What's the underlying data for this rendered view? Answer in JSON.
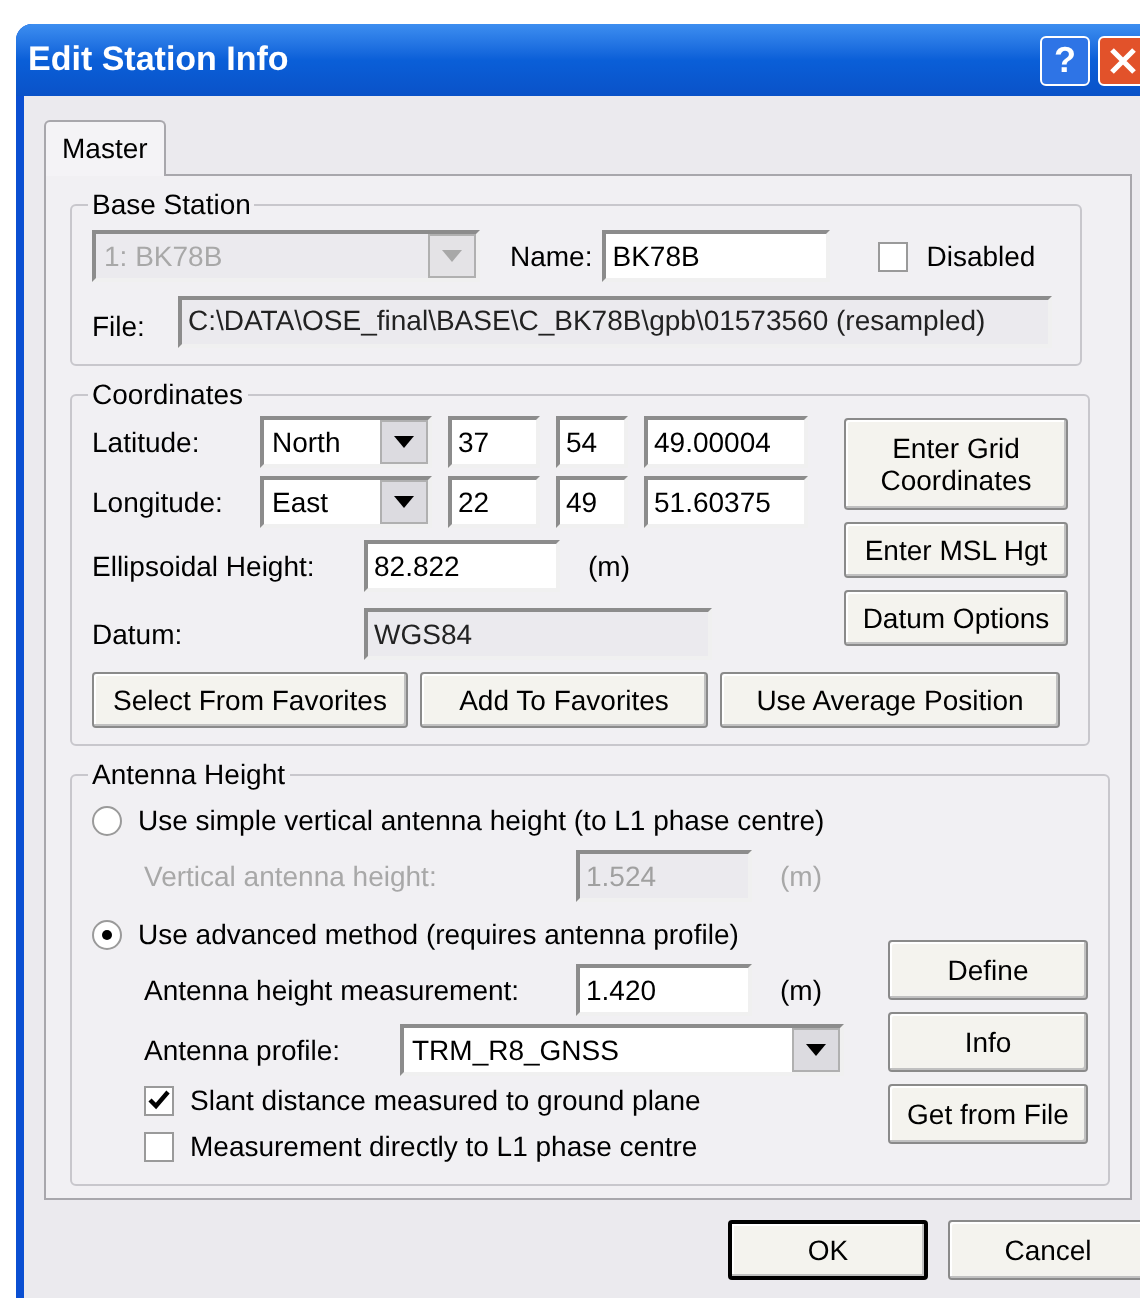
{
  "window": {
    "title": "Edit Station Info",
    "help_button": "?"
  },
  "tabs": [
    {
      "label": "Master",
      "selected": true
    }
  ],
  "base_station": {
    "title": "Base Station",
    "station": {
      "value": "1: BK78B",
      "disabled": true
    },
    "name_label": "Name:",
    "name_value": "BK78B",
    "disabled_checkbox": {
      "label": "Disabled",
      "checked": false
    },
    "file_label": "File:",
    "file_value": "C:\\DATA\\OSE_final\\BASE\\C_BK78B\\gpb\\01573560 (resampled)"
  },
  "coordinates": {
    "title": "Coordinates",
    "rows": [
      {
        "label": "Latitude:",
        "hemisphere": "North",
        "degrees": "37",
        "minutes": "54",
        "seconds": "49.00004"
      },
      {
        "label": "Longitude:",
        "hemisphere": "East",
        "degrees": "22",
        "minutes": "49",
        "seconds": "51.60375"
      }
    ],
    "height_label": "Ellipsoidal Height:",
    "height_value": "82.822",
    "height_unit": "(m)",
    "datum_label": "Datum:",
    "datum_value": "WGS84",
    "side_buttons": [
      "Enter Grid Coordinates",
      "Enter MSL Hgt",
      "Datum Options"
    ],
    "bottom_buttons": [
      "Select From Favorites",
      "Add To Favorites",
      "Use Average Position"
    ]
  },
  "antenna": {
    "title": "Antenna Height",
    "options": [
      {
        "label": "Use simple vertical antenna height (to L1 phase centre)",
        "selected": false
      },
      {
        "label": "Use advanced method (requires antenna profile)",
        "selected": true
      }
    ],
    "vertical": {
      "label": "Vertical antenna height:",
      "value": "1.524",
      "unit": "(m)",
      "disabled": true
    },
    "measurement": {
      "label": "Antenna height measurement:",
      "value": "1.420",
      "unit": "(m)"
    },
    "profile": {
      "label": "Antenna profile:",
      "value": "TRM_R8_GNSS"
    },
    "checkboxes": [
      {
        "label": "Slant distance measured to ground plane",
        "checked": true
      },
      {
        "label": "Measurement directly to L1 phase centre",
        "checked": false
      }
    ],
    "buttons": [
      "Define",
      "Info",
      "Get from File"
    ]
  },
  "footer_buttons": [
    {
      "label": "OK",
      "default": true
    },
    {
      "label": "Cancel",
      "default": false
    }
  ]
}
